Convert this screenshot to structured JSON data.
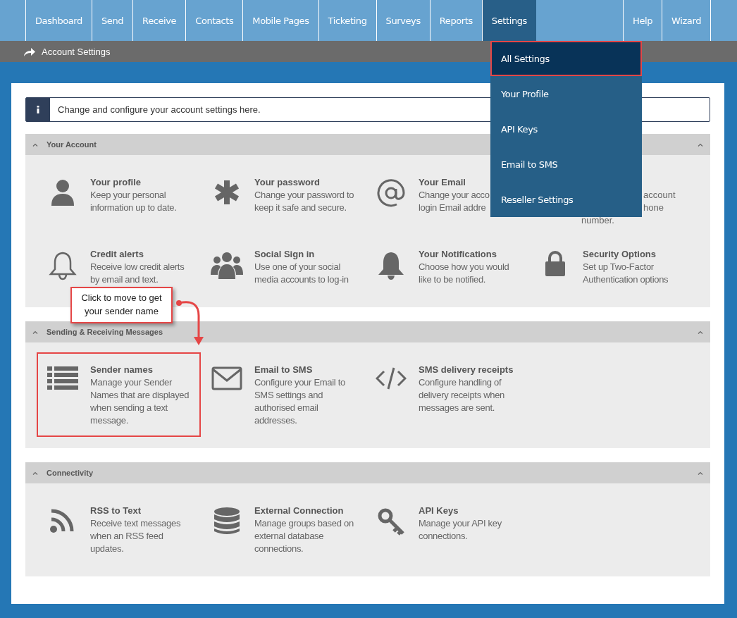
{
  "nav": {
    "tabs": [
      {
        "label": "Dashboard",
        "selected": false
      },
      {
        "label": "Send",
        "selected": false
      },
      {
        "label": "Receive",
        "selected": false
      },
      {
        "label": "Contacts",
        "selected": false
      },
      {
        "label": "Mobile Pages",
        "selected": false
      },
      {
        "label": "Ticketing",
        "selected": false
      },
      {
        "label": "Surveys",
        "selected": false
      },
      {
        "label": "Reports",
        "selected": false
      },
      {
        "label": "Settings",
        "selected": true
      }
    ],
    "right_tabs": [
      {
        "label": "Help",
        "selected": false
      },
      {
        "label": "Wizard",
        "selected": false
      }
    ],
    "dropdown": [
      {
        "label": "All Settings",
        "highlighted": true
      },
      {
        "label": "Your Profile",
        "highlighted": false
      },
      {
        "label": "API Keys",
        "highlighted": false
      },
      {
        "label": "Email to SMS",
        "highlighted": false
      },
      {
        "label": "Reseller Settings",
        "highlighted": false
      }
    ]
  },
  "breadcrumb": "Account Settings",
  "info": "Change and configure your account settings here.",
  "sections": [
    {
      "title": "Your Account",
      "items": [
        {
          "kind": "tile",
          "title": "Your profile",
          "desc": "Keep your personal information up to date.",
          "highlighted": false
        },
        {
          "kind": "tile",
          "title": "Your password",
          "desc": "Change your password to keep it safe and secure.",
          "highlighted": false
        },
        {
          "kind": "tile",
          "title": "Your Email",
          "desc": "Change your acco\nlogin Email addre",
          "highlighted": false
        },
        {
          "kind": "partial",
          "lines": [
            "account",
            "hone",
            "number."
          ],
          "highlighted": false
        },
        {
          "kind": "tile",
          "title": "Credit alerts",
          "desc": "Receive low credit alerts by email and text.",
          "highlighted": false
        },
        {
          "kind": "tile",
          "title": "Social Sign in",
          "desc": "Use one of your social media accounts to log-in",
          "highlighted": false
        },
        {
          "kind": "tile",
          "title": "Your Notifications",
          "desc": "Choose how you would like to be notified.",
          "highlighted": false
        },
        {
          "kind": "tile",
          "title": "Security Options",
          "desc": "Set up Two-Factor Authentication options",
          "highlighted": false
        }
      ]
    },
    {
      "title": "Sending & Receiving Messages",
      "items": [
        {
          "kind": "tile",
          "title": "Sender names",
          "desc": "Manage your Sender Names that are displayed when sending a text message.",
          "highlighted": true
        },
        {
          "kind": "tile",
          "title": "Email to SMS",
          "desc": "Configure your Email to SMS settings and authorised email addresses.",
          "highlighted": false
        },
        {
          "kind": "tile",
          "title": "SMS delivery receipts",
          "desc": "Configure handling of delivery receipts when messages are sent.",
          "highlighted": false
        }
      ]
    },
    {
      "title": "Connectivity",
      "items": [
        {
          "kind": "tile",
          "title": "RSS to Text",
          "desc": "Receive text messages when an RSS feed updates.",
          "highlighted": false
        },
        {
          "kind": "tile",
          "title": "External Connection",
          "desc": "Manage groups based on external database connections.",
          "highlighted": false
        },
        {
          "kind": "tile",
          "title": "API Keys",
          "desc": "Manage your API key connections.",
          "highlighted": false
        }
      ]
    }
  ],
  "callout": "Click to move to get your sender name"
}
